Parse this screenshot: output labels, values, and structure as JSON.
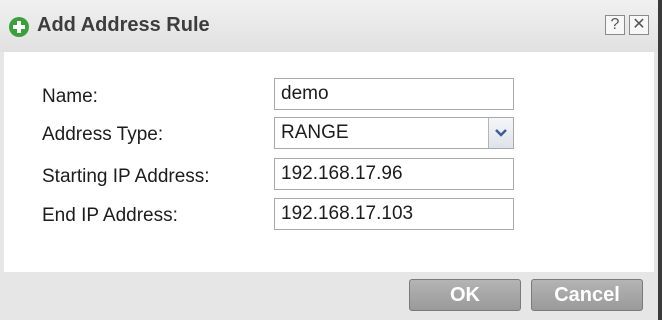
{
  "dialog": {
    "title": "Add Address Rule",
    "help_label": "?",
    "close_label": "✕"
  },
  "form": {
    "name": {
      "label": "Name:",
      "value": "demo"
    },
    "address_type": {
      "label": "Address Type:",
      "value": "RANGE"
    },
    "start_ip": {
      "label": "Starting IP Address:",
      "value": "192.168.17.96"
    },
    "end_ip": {
      "label": "End IP Address:",
      "value": "192.168.17.103"
    }
  },
  "footer": {
    "ok_label": "OK",
    "cancel_label": "Cancel"
  },
  "colors": {
    "add_icon": "#3aa13a",
    "button_bg": "#a8a8a8",
    "arrow": "#3a5f9a"
  },
  "icons": {
    "title": "add-circle-icon",
    "dropdown": "chevron-down-icon"
  }
}
